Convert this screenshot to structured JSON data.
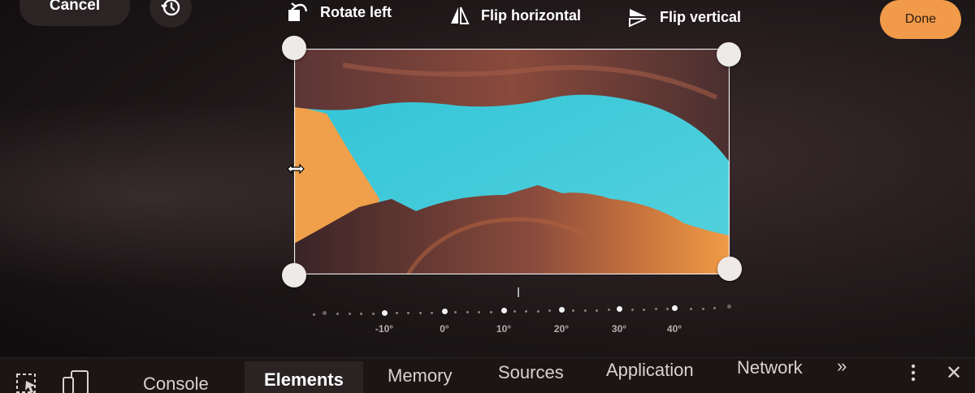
{
  "toolbar": {
    "cancel_label": "Cancel",
    "history_icon": "history-icon",
    "rotate_label": "Rotate left",
    "flip_h_label": "Flip horizontal",
    "flip_v_label": "Flip vertical",
    "done_label": "Done"
  },
  "colors": {
    "accent": "#f09a4a",
    "sky": "#3ec9d8",
    "rock_orange": "#f2a24c",
    "rock_dark": "#4b2a2a",
    "handle": "#eeeae7"
  },
  "ruler": {
    "labels": [
      "-10°",
      "0°",
      "10°",
      "20°",
      "30°",
      "40°"
    ]
  },
  "devtools": {
    "tabs": [
      {
        "label": "Console"
      },
      {
        "label": "Elements"
      },
      {
        "label": "Memory"
      },
      {
        "label": "Sources"
      },
      {
        "label": "Application"
      },
      {
        "label": "Network"
      }
    ],
    "more_label": "»",
    "close_label": "✕"
  }
}
